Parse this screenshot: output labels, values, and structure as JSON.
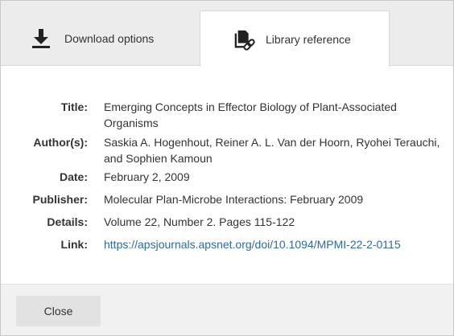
{
  "tabs": {
    "download": {
      "label": "Download options",
      "icon": "download-icon"
    },
    "library": {
      "label": "Library reference",
      "icon": "document-link-icon"
    }
  },
  "details": {
    "title_label": "Title:",
    "title_line1": "Emerging Concepts in Effector Biology of Plant-Associated",
    "title_line2": "Organisms",
    "authors_label": "Author(s):",
    "authors_line1": "Saskia A. Hogenhout, Reiner A. L. Van der Hoorn, Ryohei Terauchi,",
    "authors_line2": "and Sophien Kamoun",
    "date_label": "Date:",
    "date": "February 2, 2009",
    "publisher_label": "Publisher:",
    "publisher": "Molecular Plan-Microbe Interactions: February 2009",
    "details_label": "Details:",
    "details": "Volume 22, Number 2. Pages 115-122",
    "link_label": "Link:",
    "link": "https://apsjournals.apsnet.org/doi/10.1094/MPMI-22-2-0115"
  },
  "footer": {
    "close_label": "Close"
  },
  "colors": {
    "link": "#2a6aa5",
    "tab_bar": "#ececec",
    "footer": "#f1f1f1",
    "button": "#e2e2e2"
  }
}
